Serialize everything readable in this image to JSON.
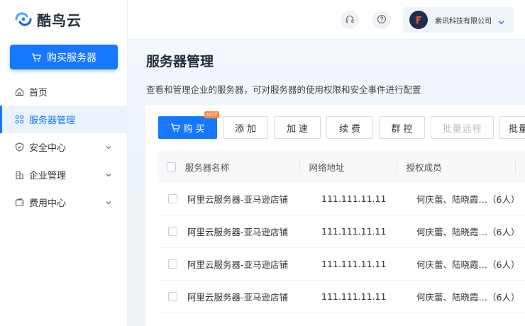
{
  "brand": {
    "name": "酷鸟云"
  },
  "sidebar": {
    "buy_label": "购买服务器",
    "items": [
      {
        "label": "首页",
        "icon": "home-icon"
      },
      {
        "label": "服务器管理",
        "icon": "grid-icon",
        "active": true
      },
      {
        "label": "安全中心",
        "icon": "shield-icon",
        "expandable": true
      },
      {
        "label": "企业管理",
        "icon": "building-icon",
        "expandable": true
      },
      {
        "label": "费用中心",
        "icon": "wallet-icon",
        "expandable": true
      }
    ]
  },
  "header": {
    "company_name": "紫讯科技有限公司",
    "icons": [
      "headset-icon",
      "help-icon"
    ]
  },
  "main": {
    "title": "服务器管理",
    "description": "查看和管理企业的服务器，可对服务器的使用权限和安全事件进行配置",
    "toolbar": {
      "buy": "购买",
      "hot": "HOT",
      "add": "添加",
      "speed": "加速",
      "renew": "续费",
      "group": "群控",
      "batch_remote": "批量远程",
      "batch_more": "批量"
    },
    "table": {
      "columns": [
        "服务器名称",
        "网络地址",
        "授权成员"
      ],
      "rows": [
        {
          "name": "阿里云服务器-亚马逊店铺",
          "ip": "111.111.11.11",
          "members": "何庆蕾、陆晓霞…（6人）"
        },
        {
          "name": "阿里云服务器-亚马逊店铺",
          "ip": "111.111.11.11",
          "members": "何庆蕾、陆晓霞…（6人）"
        },
        {
          "name": "阿里云服务器-亚马逊店铺",
          "ip": "111.111.11.11",
          "members": "何庆蕾、陆晓霞…（6人）"
        },
        {
          "name": "阿里云服务器-亚马逊店铺",
          "ip": "111.111.11.11",
          "members": "何庆蕾、陆晓霞…（6人）"
        }
      ]
    }
  },
  "colors": {
    "primary": "#1677ff",
    "hot": "#ff8a3d",
    "active_bg": "#eaf2ff"
  }
}
